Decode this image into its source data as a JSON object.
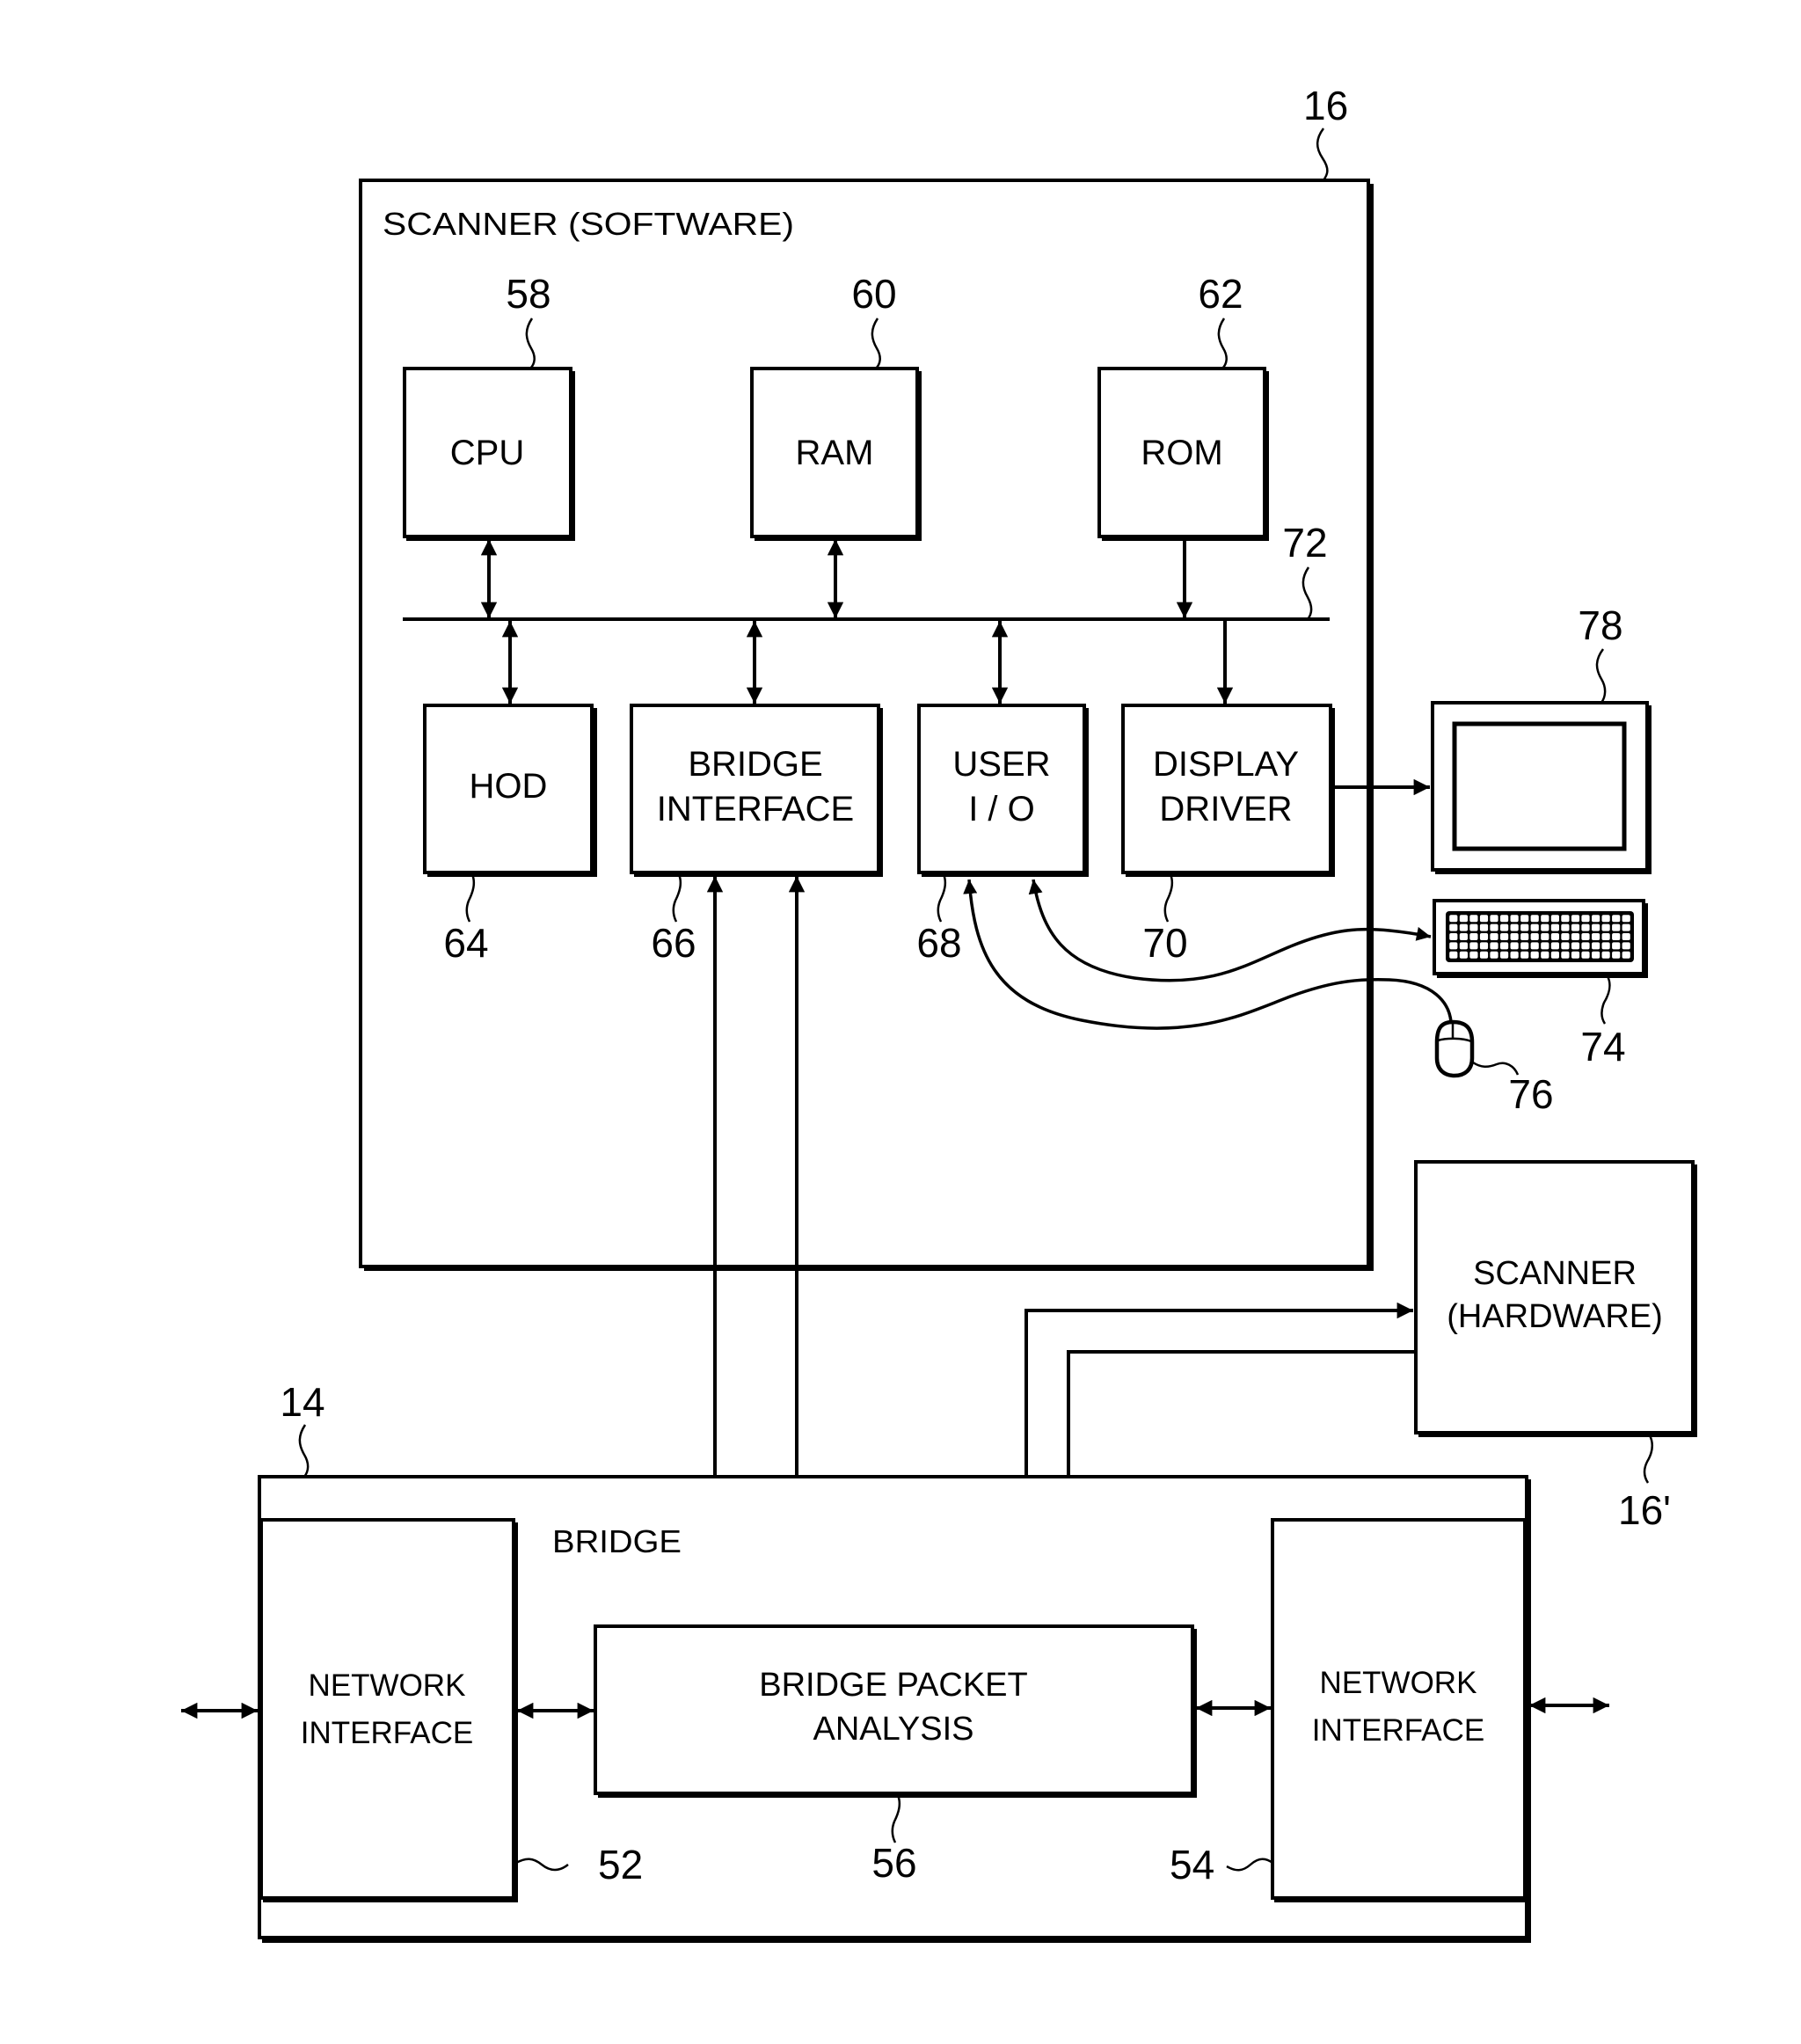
{
  "figure": {
    "scanner_software": {
      "ref": "16",
      "title": "SCANNER (SOFTWARE)",
      "components": {
        "cpu": {
          "label": "CPU",
          "ref": "58"
        },
        "ram": {
          "label": "RAM",
          "ref": "60"
        },
        "rom": {
          "label": "ROM",
          "ref": "62"
        },
        "hod": {
          "label": "HOD",
          "ref": "64"
        },
        "bridge_interface": {
          "line1": "BRIDGE",
          "line2": "INTERFACE",
          "ref": "66"
        },
        "user_io": {
          "line1": "USER",
          "line2": "I / O",
          "ref": "68"
        },
        "display_driver": {
          "line1": "DISPLAY",
          "line2": "DRIVER",
          "ref": "70"
        }
      },
      "bus": {
        "ref": "72"
      }
    },
    "peripherals": {
      "monitor": {
        "ref": "78"
      },
      "keyboard": {
        "ref": "74",
        "key_rows": 5,
        "key_cols": 18
      },
      "mouse": {
        "ref": "76"
      }
    },
    "scanner_hardware": {
      "line1": "SCANNER",
      "line2": "(HARDWARE)",
      "ref": "16'"
    },
    "bridge": {
      "ref": "14",
      "title": "BRIDGE",
      "network_interface_left": {
        "line1": "NETWORK",
        "line2": "INTERFACE",
        "ref": "52"
      },
      "network_interface_right": {
        "line1": "NETWORK",
        "line2": "INTERFACE",
        "ref": "54"
      },
      "packet_analysis": {
        "line1": "BRIDGE PACKET",
        "line2": "ANALYSIS",
        "ref": "56"
      }
    }
  }
}
